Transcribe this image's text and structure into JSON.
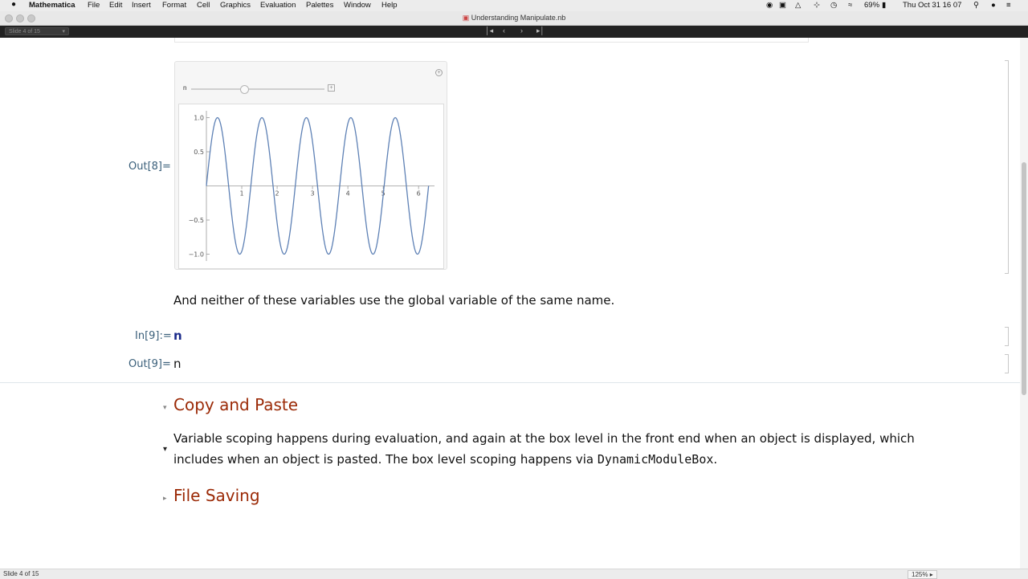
{
  "menubar": {
    "apple_icon": "apple-icon",
    "app_name": "Mathematica",
    "items": [
      "File",
      "Edit",
      "Insert",
      "Format",
      "Cell",
      "Graphics",
      "Evaluation",
      "Palettes",
      "Window",
      "Help"
    ],
    "battery": "69%",
    "clock": "Thu Oct 31  16 07"
  },
  "window": {
    "title": "Understanding Manipulate.nb"
  },
  "toolbar": {
    "slide_select": "Slide 4 of 15"
  },
  "cells": {
    "out8_label": "Out[8]=",
    "slider_var": "n",
    "text1": "And neither of these variables use the global variable of the same name.",
    "in9_label": "In[9]:=",
    "in9_input": "n",
    "out9_label": "Out[9]=",
    "out9_output": "n",
    "section1": "Copy and Paste",
    "para_line1": "Variable scoping happens during evaluation, and again at the box level in the front end when an object is displayed, which",
    "para_line2a": "includes when an object is pasted. The box level scoping happens via ",
    "para_code": "DynamicModuleBox",
    "para_line2b": ".",
    "section2": "File Saving"
  },
  "status": {
    "slide": "Slide 4 of 15",
    "zoom": "125%"
  },
  "slider": {
    "value_fraction": 0.39
  },
  "chart_data": {
    "type": "line",
    "series": [
      {
        "function": "sin(5x)",
        "x_range": [
          0,
          6.2832
        ],
        "color": "#5e81b5"
      }
    ],
    "xticks": [
      1,
      2,
      3,
      4,
      5,
      6
    ],
    "yticks": [
      1.0,
      0.5,
      -0.5,
      -1.0
    ],
    "ytick_labels": [
      "1.0",
      "0.5",
      "−0.5",
      "−1.0"
    ],
    "xlim": [
      0,
      6.45
    ],
    "ylim": [
      -1.1,
      1.1
    ]
  }
}
